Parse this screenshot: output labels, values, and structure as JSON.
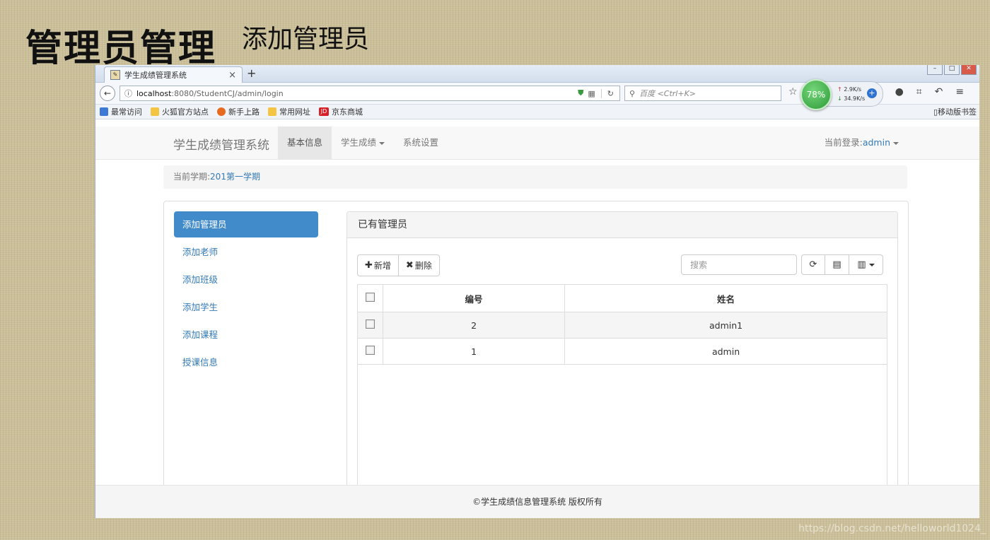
{
  "slide": {
    "title": "管理员管理",
    "subtitle": "添加管理员"
  },
  "browser": {
    "tab_title": "学生成绩管理系统",
    "tab_close": "×",
    "new_tab": "+",
    "url_host": "localhost",
    "url_path": ":8080/StudentCJ/admin/login",
    "search_placeholder": "百度 <Ctrl+K>",
    "speed": {
      "percent": "78%",
      "up": "2.9K/s",
      "down": "34.9K/s"
    },
    "bookmarks": [
      "最常访问",
      "火狐官方站点",
      "新手上路",
      "常用网址",
      "京东商城"
    ],
    "bookmark_right": "移动版书签"
  },
  "app": {
    "brand": "学生成绩管理系统",
    "menu": [
      "基本信息",
      "学生成绩",
      "系统设置"
    ],
    "login_label": "当前登录:",
    "login_user": "admin",
    "term_label": "当前学期:",
    "term_value": "201第一学期",
    "sidebar": [
      "添加管理员",
      "添加老师",
      "添加班级",
      "添加学生",
      "添加课程",
      "授课信息"
    ],
    "panel_title": "已有管理员",
    "btn_add": "新增",
    "btn_delete": "删除",
    "search_placeholder": "搜索",
    "table": {
      "headers": [
        "编号",
        "姓名"
      ],
      "rows": [
        {
          "id": "2",
          "name": "admin1"
        },
        {
          "id": "1",
          "name": "admin"
        }
      ]
    },
    "footer": "©学生成绩信息管理系统 版权所有"
  },
  "watermark": "https://blog.csdn.net/helloworld1024_"
}
